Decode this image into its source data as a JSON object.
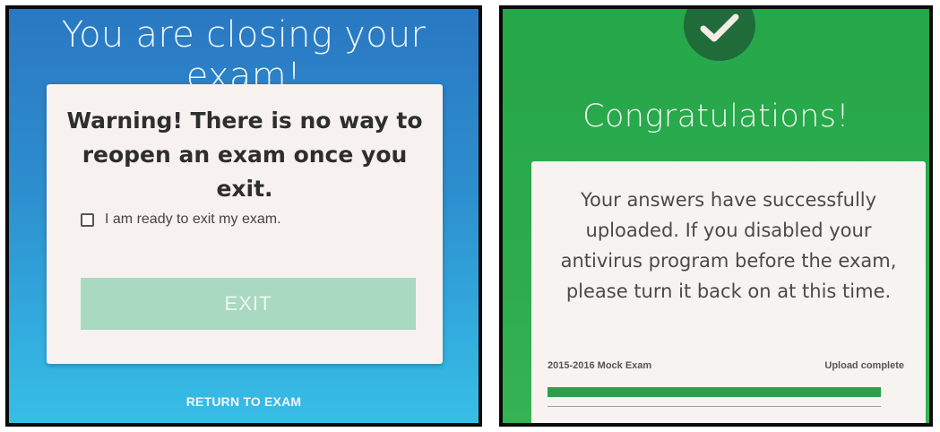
{
  "left_screen": {
    "title": "You are closing your exam!",
    "warning": "Warning! There is no way to reopen an exam once you exit.",
    "checkbox_label": "I am ready to exit my exam.",
    "checkbox_checked": false,
    "exit_button_label": "EXIT",
    "return_link_label": "RETURN TO EXAM",
    "colors": {
      "background": "#2d8fcf",
      "exit_button": "#a9d9c0"
    }
  },
  "right_screen": {
    "icon": "check-icon",
    "title": "Congratulations!",
    "message": "Your answers have successfully uploaded. If you disabled your antivirus program before the exam, please turn it back on at this time.",
    "exam_name": "2015-2016 Mock Exam",
    "status": "Upload complete",
    "progress": 1.0,
    "colors": {
      "background": "#2bab4d",
      "progress_fill": "#2e9e4b"
    }
  }
}
